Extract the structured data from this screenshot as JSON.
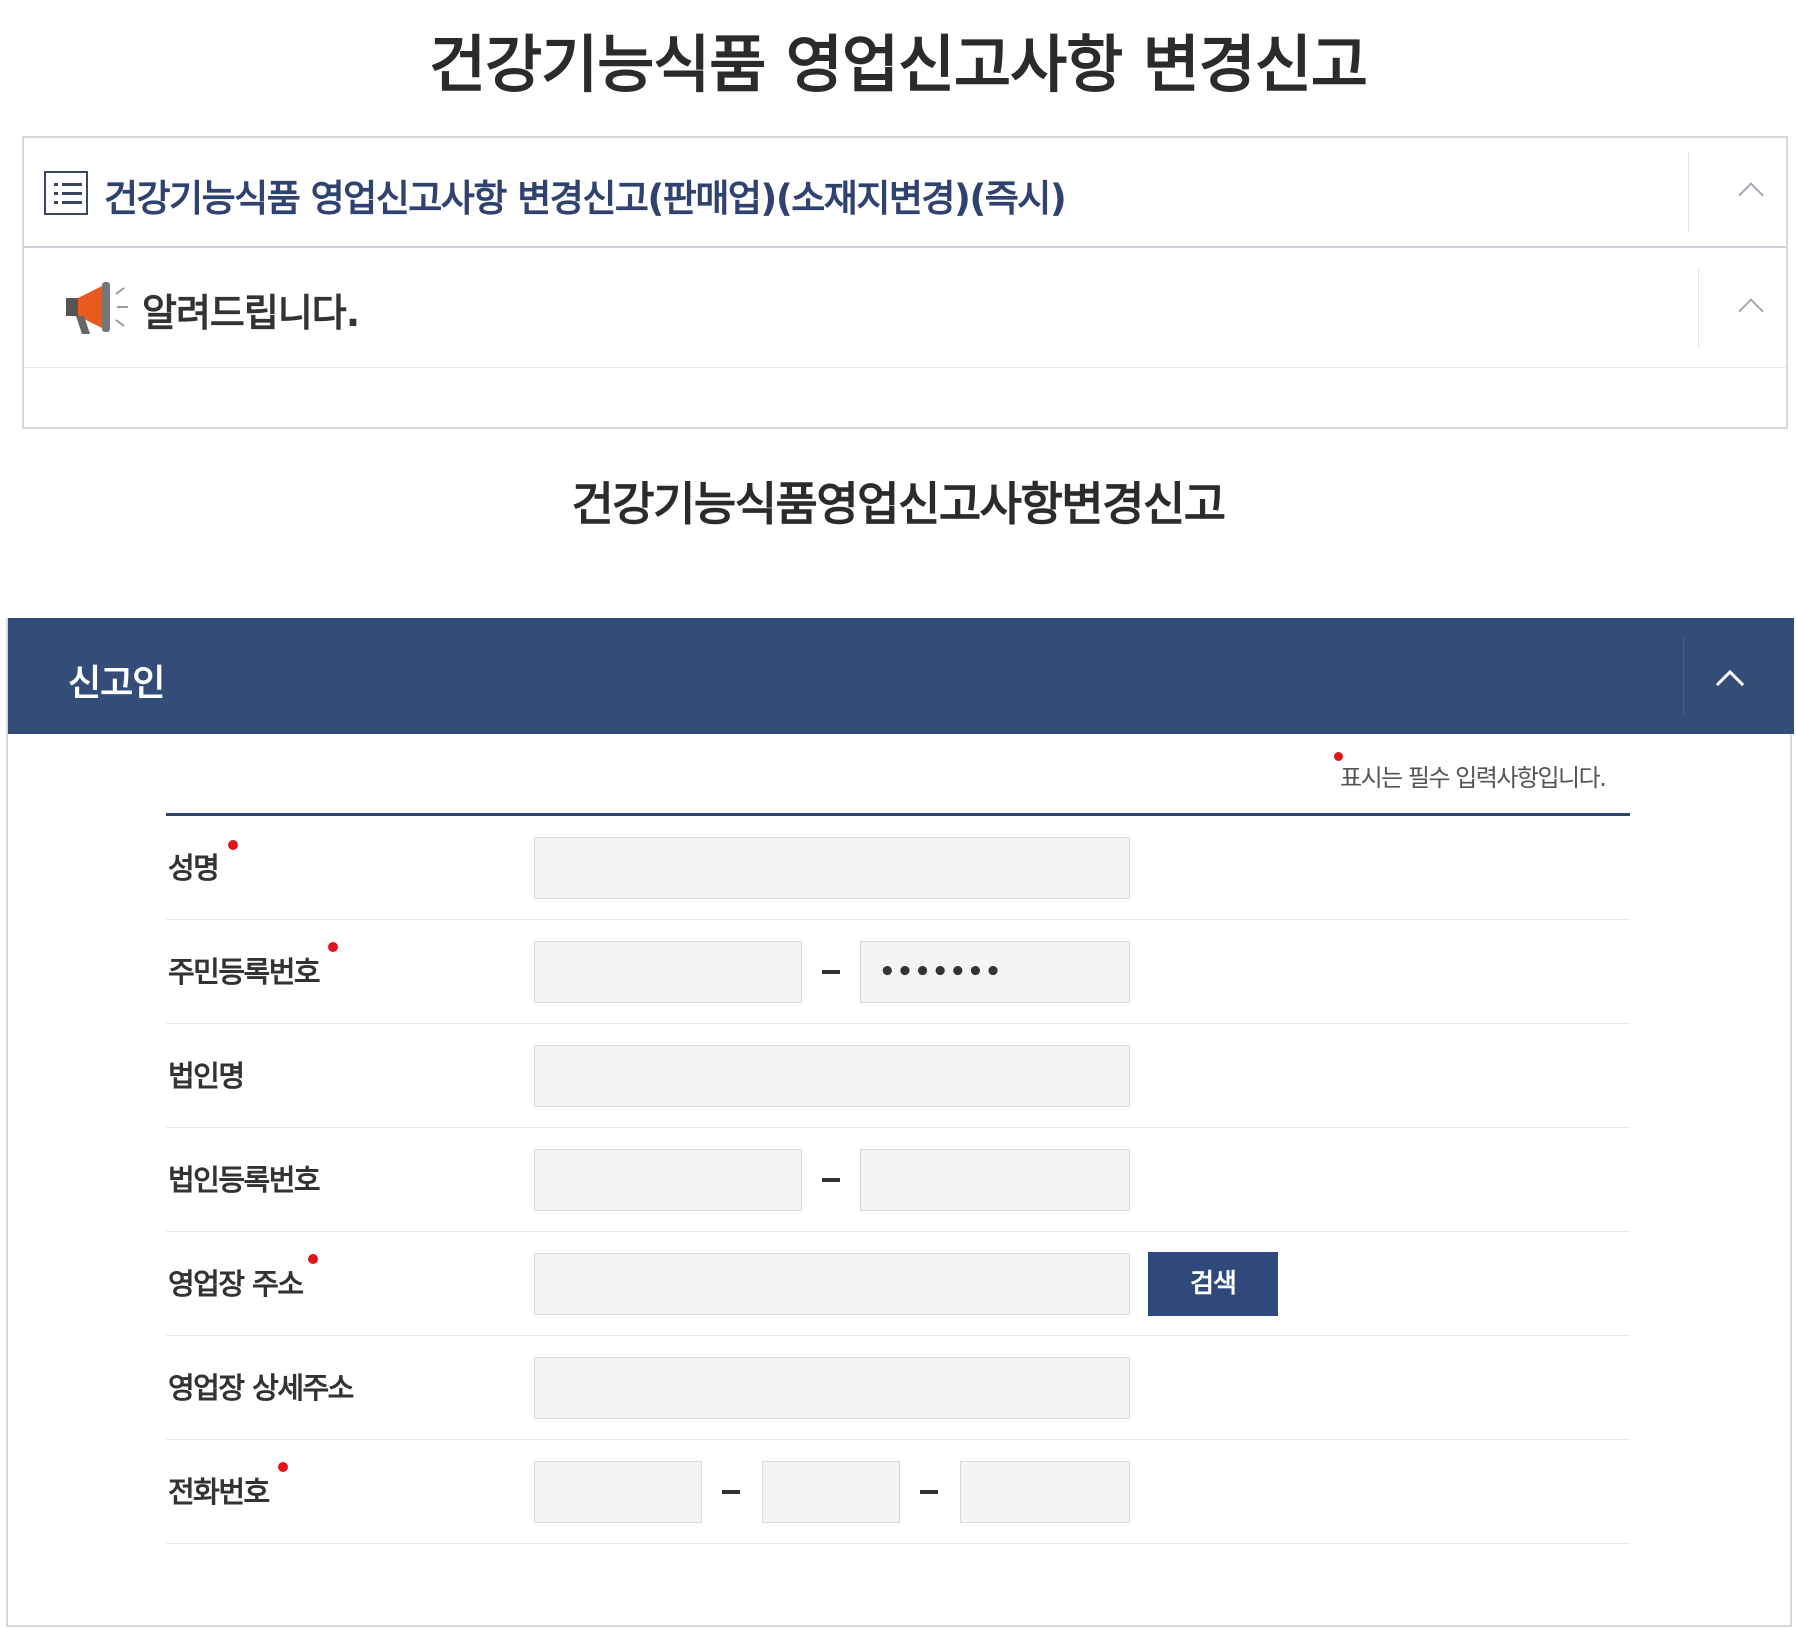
{
  "page_title": "건강기능식품 영업신고사항 변경신고",
  "accordion": {
    "title": "건강기능식품 영업신고사항 변경신고(판매업)(소재지변경)(즉시)",
    "notice_label": "알려드립니다."
  },
  "sub_title": "건강기능식품영업신고사항변경신고",
  "section": {
    "title": "신고인",
    "required_note": "표시는 필수 입력사항입니다."
  },
  "form": {
    "name_label": "성명",
    "rrn_label": "주민등록번호",
    "rrn_back_value": "•••••••",
    "corp_name_label": "법인명",
    "corp_reg_label": "법인등록번호",
    "biz_addr_label": "영업장 주소",
    "search_button": "검색",
    "biz_detail_addr_label": "영업장 상세주소",
    "phone_label": "전화번호"
  },
  "colors": {
    "header_bg": "#344c78",
    "accent_title": "#2f4270",
    "required_dot": "#e0141b",
    "button_bg": "#2f4a7a"
  }
}
